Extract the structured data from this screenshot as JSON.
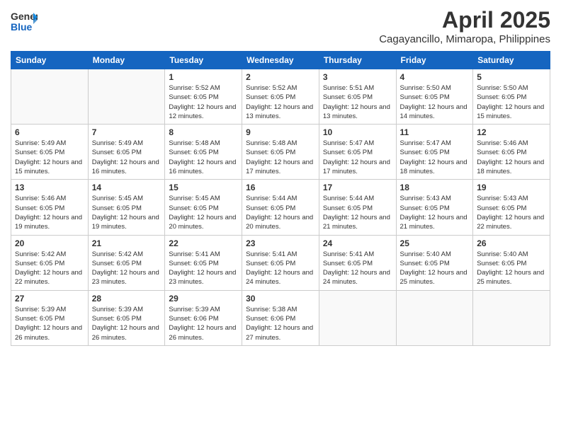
{
  "header": {
    "logo_line1": "General",
    "logo_line2": "Blue",
    "month": "April 2025",
    "location": "Cagayancillo, Mimaropa, Philippines"
  },
  "weekdays": [
    "Sunday",
    "Monday",
    "Tuesday",
    "Wednesday",
    "Thursday",
    "Friday",
    "Saturday"
  ],
  "weeks": [
    [
      {
        "num": "",
        "sunrise": "",
        "sunset": "",
        "daylight": ""
      },
      {
        "num": "",
        "sunrise": "",
        "sunset": "",
        "daylight": ""
      },
      {
        "num": "1",
        "sunrise": "Sunrise: 5:52 AM",
        "sunset": "Sunset: 6:05 PM",
        "daylight": "Daylight: 12 hours and 12 minutes."
      },
      {
        "num": "2",
        "sunrise": "Sunrise: 5:52 AM",
        "sunset": "Sunset: 6:05 PM",
        "daylight": "Daylight: 12 hours and 13 minutes."
      },
      {
        "num": "3",
        "sunrise": "Sunrise: 5:51 AM",
        "sunset": "Sunset: 6:05 PM",
        "daylight": "Daylight: 12 hours and 13 minutes."
      },
      {
        "num": "4",
        "sunrise": "Sunrise: 5:50 AM",
        "sunset": "Sunset: 6:05 PM",
        "daylight": "Daylight: 12 hours and 14 minutes."
      },
      {
        "num": "5",
        "sunrise": "Sunrise: 5:50 AM",
        "sunset": "Sunset: 6:05 PM",
        "daylight": "Daylight: 12 hours and 15 minutes."
      }
    ],
    [
      {
        "num": "6",
        "sunrise": "Sunrise: 5:49 AM",
        "sunset": "Sunset: 6:05 PM",
        "daylight": "Daylight: 12 hours and 15 minutes."
      },
      {
        "num": "7",
        "sunrise": "Sunrise: 5:49 AM",
        "sunset": "Sunset: 6:05 PM",
        "daylight": "Daylight: 12 hours and 16 minutes."
      },
      {
        "num": "8",
        "sunrise": "Sunrise: 5:48 AM",
        "sunset": "Sunset: 6:05 PM",
        "daylight": "Daylight: 12 hours and 16 minutes."
      },
      {
        "num": "9",
        "sunrise": "Sunrise: 5:48 AM",
        "sunset": "Sunset: 6:05 PM",
        "daylight": "Daylight: 12 hours and 17 minutes."
      },
      {
        "num": "10",
        "sunrise": "Sunrise: 5:47 AM",
        "sunset": "Sunset: 6:05 PM",
        "daylight": "Daylight: 12 hours and 17 minutes."
      },
      {
        "num": "11",
        "sunrise": "Sunrise: 5:47 AM",
        "sunset": "Sunset: 6:05 PM",
        "daylight": "Daylight: 12 hours and 18 minutes."
      },
      {
        "num": "12",
        "sunrise": "Sunrise: 5:46 AM",
        "sunset": "Sunset: 6:05 PM",
        "daylight": "Daylight: 12 hours and 18 minutes."
      }
    ],
    [
      {
        "num": "13",
        "sunrise": "Sunrise: 5:46 AM",
        "sunset": "Sunset: 6:05 PM",
        "daylight": "Daylight: 12 hours and 19 minutes."
      },
      {
        "num": "14",
        "sunrise": "Sunrise: 5:45 AM",
        "sunset": "Sunset: 6:05 PM",
        "daylight": "Daylight: 12 hours and 19 minutes."
      },
      {
        "num": "15",
        "sunrise": "Sunrise: 5:45 AM",
        "sunset": "Sunset: 6:05 PM",
        "daylight": "Daylight: 12 hours and 20 minutes."
      },
      {
        "num": "16",
        "sunrise": "Sunrise: 5:44 AM",
        "sunset": "Sunset: 6:05 PM",
        "daylight": "Daylight: 12 hours and 20 minutes."
      },
      {
        "num": "17",
        "sunrise": "Sunrise: 5:44 AM",
        "sunset": "Sunset: 6:05 PM",
        "daylight": "Daylight: 12 hours and 21 minutes."
      },
      {
        "num": "18",
        "sunrise": "Sunrise: 5:43 AM",
        "sunset": "Sunset: 6:05 PM",
        "daylight": "Daylight: 12 hours and 21 minutes."
      },
      {
        "num": "19",
        "sunrise": "Sunrise: 5:43 AM",
        "sunset": "Sunset: 6:05 PM",
        "daylight": "Daylight: 12 hours and 22 minutes."
      }
    ],
    [
      {
        "num": "20",
        "sunrise": "Sunrise: 5:42 AM",
        "sunset": "Sunset: 6:05 PM",
        "daylight": "Daylight: 12 hours and 22 minutes."
      },
      {
        "num": "21",
        "sunrise": "Sunrise: 5:42 AM",
        "sunset": "Sunset: 6:05 PM",
        "daylight": "Daylight: 12 hours and 23 minutes."
      },
      {
        "num": "22",
        "sunrise": "Sunrise: 5:41 AM",
        "sunset": "Sunset: 6:05 PM",
        "daylight": "Daylight: 12 hours and 23 minutes."
      },
      {
        "num": "23",
        "sunrise": "Sunrise: 5:41 AM",
        "sunset": "Sunset: 6:05 PM",
        "daylight": "Daylight: 12 hours and 24 minutes."
      },
      {
        "num": "24",
        "sunrise": "Sunrise: 5:41 AM",
        "sunset": "Sunset: 6:05 PM",
        "daylight": "Daylight: 12 hours and 24 minutes."
      },
      {
        "num": "25",
        "sunrise": "Sunrise: 5:40 AM",
        "sunset": "Sunset: 6:05 PM",
        "daylight": "Daylight: 12 hours and 25 minutes."
      },
      {
        "num": "26",
        "sunrise": "Sunrise: 5:40 AM",
        "sunset": "Sunset: 6:05 PM",
        "daylight": "Daylight: 12 hours and 25 minutes."
      }
    ],
    [
      {
        "num": "27",
        "sunrise": "Sunrise: 5:39 AM",
        "sunset": "Sunset: 6:05 PM",
        "daylight": "Daylight: 12 hours and 26 minutes."
      },
      {
        "num": "28",
        "sunrise": "Sunrise: 5:39 AM",
        "sunset": "Sunset: 6:05 PM",
        "daylight": "Daylight: 12 hours and 26 minutes."
      },
      {
        "num": "29",
        "sunrise": "Sunrise: 5:39 AM",
        "sunset": "Sunset: 6:06 PM",
        "daylight": "Daylight: 12 hours and 26 minutes."
      },
      {
        "num": "30",
        "sunrise": "Sunrise: 5:38 AM",
        "sunset": "Sunset: 6:06 PM",
        "daylight": "Daylight: 12 hours and 27 minutes."
      },
      {
        "num": "",
        "sunrise": "",
        "sunset": "",
        "daylight": ""
      },
      {
        "num": "",
        "sunrise": "",
        "sunset": "",
        "daylight": ""
      },
      {
        "num": "",
        "sunrise": "",
        "sunset": "",
        "daylight": ""
      }
    ]
  ]
}
